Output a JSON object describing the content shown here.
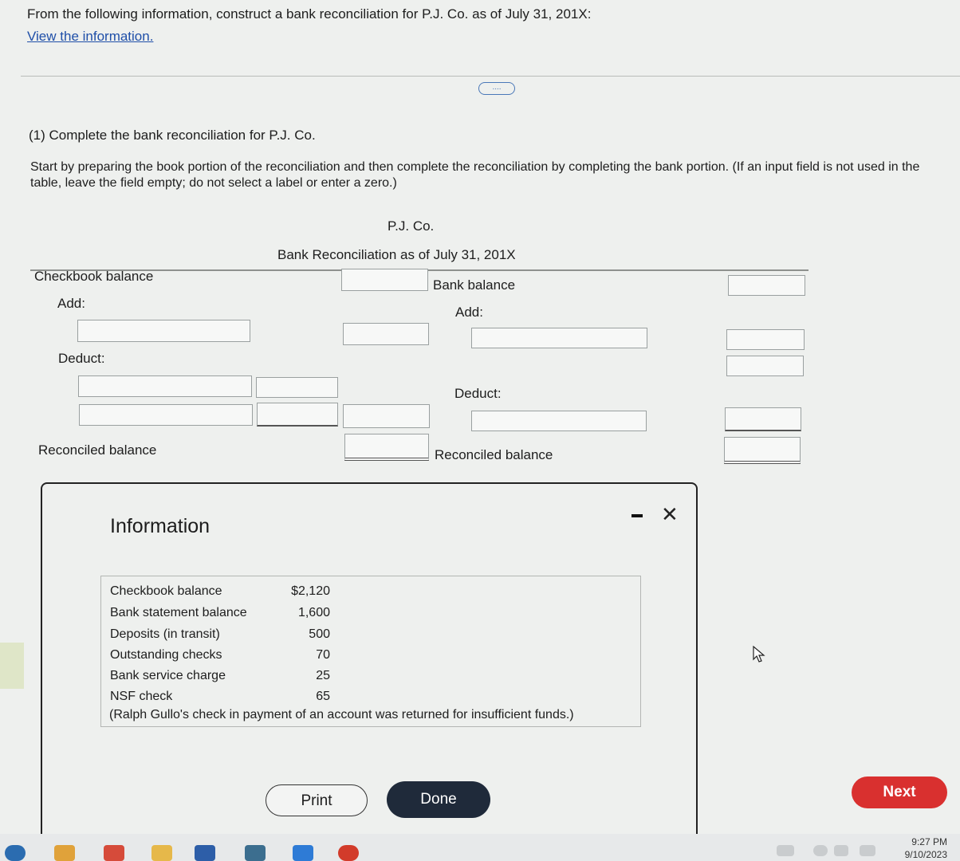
{
  "question": {
    "text": "From the following information, construct a bank reconciliation for P.J. Co. as of July 31, 201X:",
    "link": "View the information."
  },
  "expander_label": "....",
  "part": {
    "label": "(1) Complete the bank reconciliation for P.J. Co.",
    "instruction": "Start by preparing the book portion of the reconciliation and then complete the reconciliation by completing the bank portion. (If an input field is not used in the table, leave the field empty; do not select a label or enter a zero.)"
  },
  "reconciliation": {
    "company": "P.J. Co.",
    "title": "Bank Reconciliation as of July 31, 201X",
    "book": {
      "checkbook_balance": "Checkbook balance",
      "add": "Add:",
      "deduct": "Deduct:",
      "reconciled": "Reconciled balance"
    },
    "bank": {
      "bank_balance": "Bank balance",
      "add": "Add:",
      "deduct": "Deduct:",
      "reconciled": "Reconciled balance"
    }
  },
  "modal": {
    "title": "Information",
    "rows": [
      {
        "label": "Checkbook balance",
        "value": "$2,120"
      },
      {
        "label": "Bank statement balance",
        "value": "1,600"
      },
      {
        "label": "Deposits (in transit)",
        "value": "500"
      },
      {
        "label": "Outstanding checks",
        "value": "70"
      },
      {
        "label": "Bank service charge",
        "value": "25"
      },
      {
        "label": "NSF check",
        "value": "65"
      }
    ],
    "note": "(Ralph Gullo's check in payment of an account was returned for insufficient funds.)",
    "print": "Print",
    "done": "Done",
    "close_symbol": "✕"
  },
  "next": "Next",
  "clock": {
    "time": "9:27 PM",
    "date": "9/10/2023"
  },
  "colors": {
    "link": "#1f4fa8",
    "next": "#d9302f",
    "done": "#1f2a3a"
  }
}
